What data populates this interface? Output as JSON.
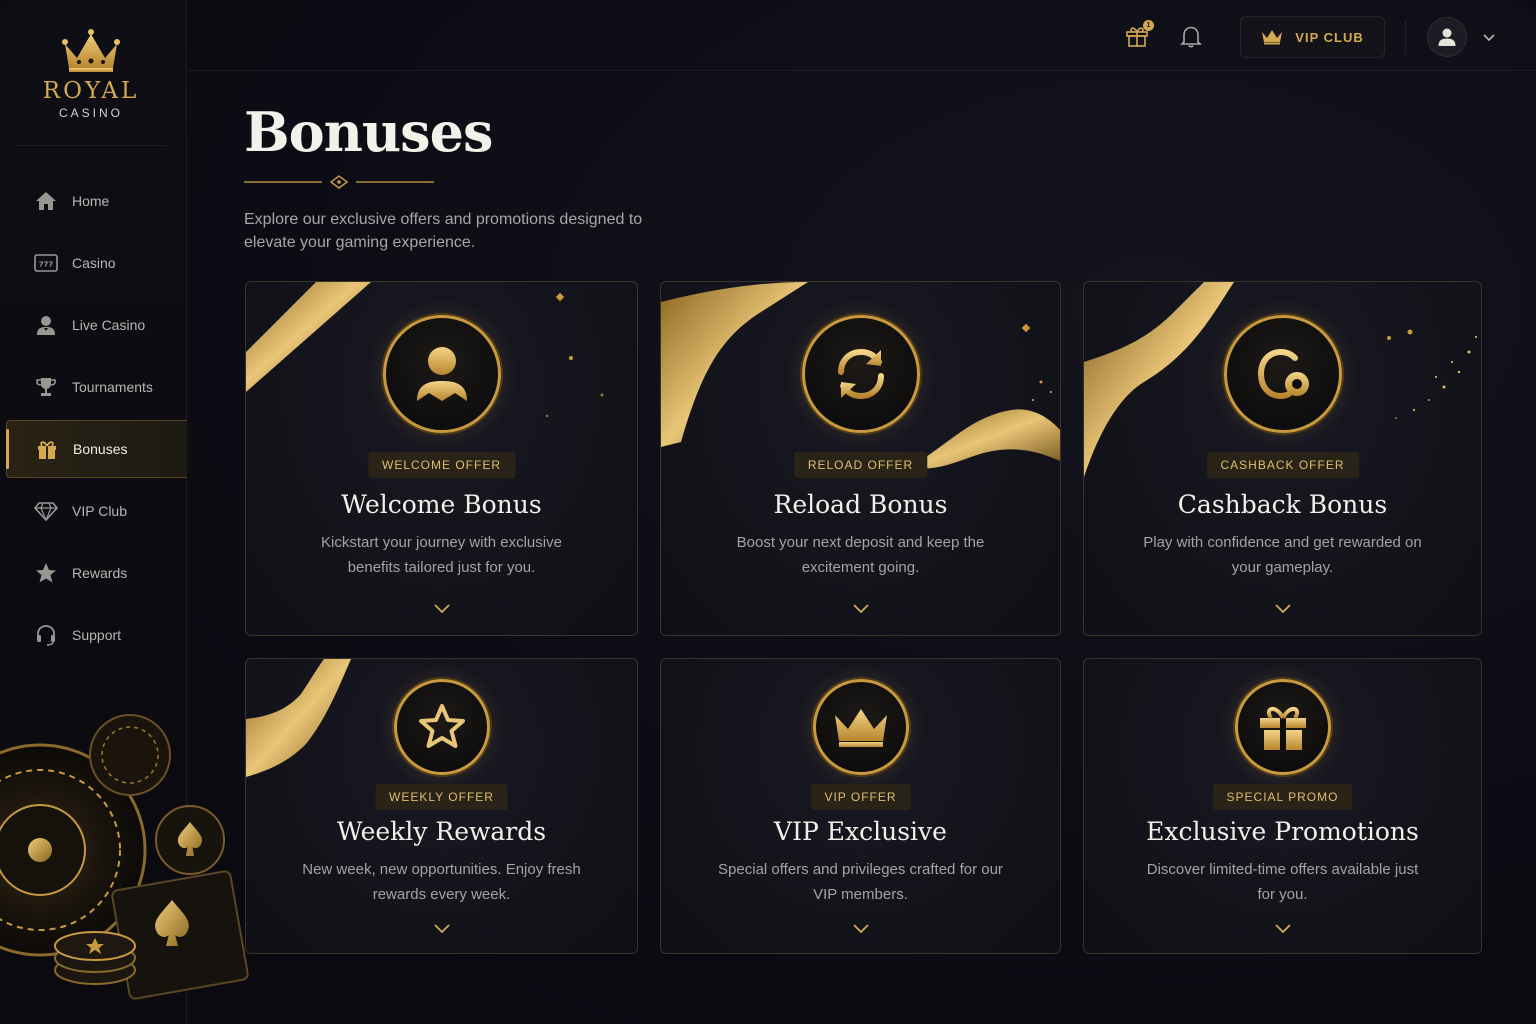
{
  "brand": {
    "title": "ROYAL",
    "subtitle": "CASINO"
  },
  "sidebar": {
    "items": [
      {
        "label": "Home",
        "icon": "home-icon"
      },
      {
        "label": "Casino",
        "icon": "slot-machine-icon"
      },
      {
        "label": "Live Casino",
        "icon": "dealer-icon"
      },
      {
        "label": "Tournaments",
        "icon": "trophy-icon"
      },
      {
        "label": "Bonuses",
        "icon": "gift-icon",
        "active": true
      },
      {
        "label": "VIP Club",
        "icon": "diamond-icon"
      },
      {
        "label": "Rewards",
        "icon": "star-icon"
      },
      {
        "label": "Support",
        "icon": "headset-icon"
      }
    ]
  },
  "topbar": {
    "gift_badge": "1",
    "vip_label": "VIP CLUB"
  },
  "page": {
    "title": "Bonuses",
    "description": "Explore our exclusive offers and promotions designed to elevate your gaming experience."
  },
  "cards": [
    {
      "badge": "WELCOME OFFER",
      "title": "Welcome Bonus",
      "desc": "Kickstart your journey with exclusive benefits tailored just for you.",
      "icon": "user-icon"
    },
    {
      "badge": "RELOAD OFFER",
      "title": "Reload Bonus",
      "desc": "Boost your next deposit and keep the excitement going.",
      "icon": "refresh-icon"
    },
    {
      "badge": "CASHBACK OFFER",
      "title": "Cashback Bonus",
      "desc": "Play with confidence and get rewarded on your gameplay.",
      "icon": "cashback-icon"
    },
    {
      "badge": "WEEKLY OFFER",
      "title": "Weekly Rewards",
      "desc": "New week, new opportunities. Enjoy fresh rewards every week.",
      "icon": "star-icon"
    },
    {
      "badge": "VIP OFFER",
      "title": "VIP Exclusive",
      "desc": "Special offers and privileges crafted for our VIP members.",
      "icon": "crown-icon"
    },
    {
      "badge": "SPECIAL PROMO",
      "title": "Exclusive Promotions",
      "desc": "Discover limited-time offers available just for you.",
      "icon": "gift-icon"
    }
  ],
  "colors": {
    "gold": "#d4a94f",
    "background": "#0b0b12",
    "card_border": "#3a3326"
  }
}
